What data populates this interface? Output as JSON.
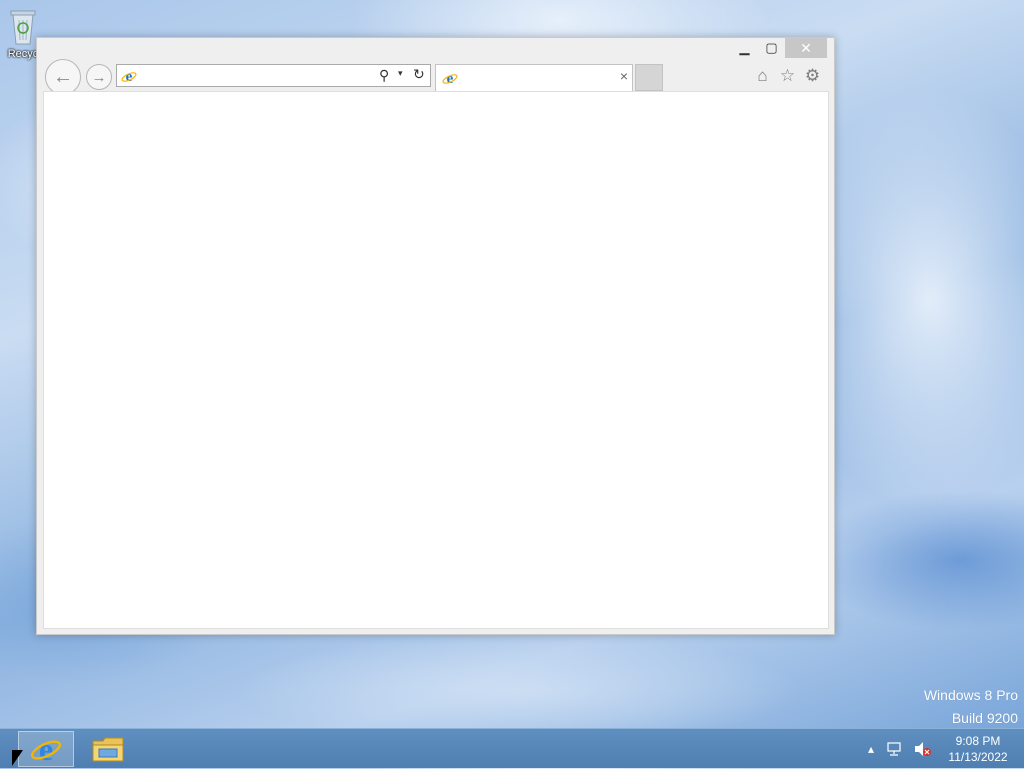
{
  "desktop": {
    "icons": [
      {
        "label": "Recyc",
        "icon": "recycle-bin-icon"
      }
    ],
    "watermark": {
      "line1": "Windows 8 Pro",
      "line2": "Build 9200"
    }
  },
  "browser": {
    "window_controls": {
      "minimize": "▁",
      "maximize": "▢",
      "close": "✕"
    },
    "nav": {
      "back": "←",
      "forward": "→"
    },
    "address": {
      "value": "",
      "placeholder": ""
    },
    "address_icons": {
      "search": "⚲",
      "dropdown": "▾",
      "refresh": "↻"
    },
    "tab": {
      "title": "",
      "close": "×"
    },
    "tools": {
      "home": "⌂",
      "favorites": "☆",
      "settings": "⚙"
    }
  },
  "taskbar": {
    "pinned": [
      {
        "name": "Internet Explorer",
        "icon": "internet-explorer-icon",
        "active": true
      },
      {
        "name": "File Explorer",
        "icon": "file-explorer-icon",
        "active": false
      }
    ],
    "tray": {
      "show_hidden": "▴",
      "network": "network-icon",
      "volume": "volume-muted-icon"
    },
    "clock": {
      "time": "9:08 PM",
      "date": "11/13/2022"
    }
  },
  "colors": {
    "window_frame": "#efefef",
    "close_button": "#c7c7c7",
    "taskbar": "#5588bb",
    "ie_blue": "#1e6fc9",
    "ie_ring": "#f2b600"
  }
}
